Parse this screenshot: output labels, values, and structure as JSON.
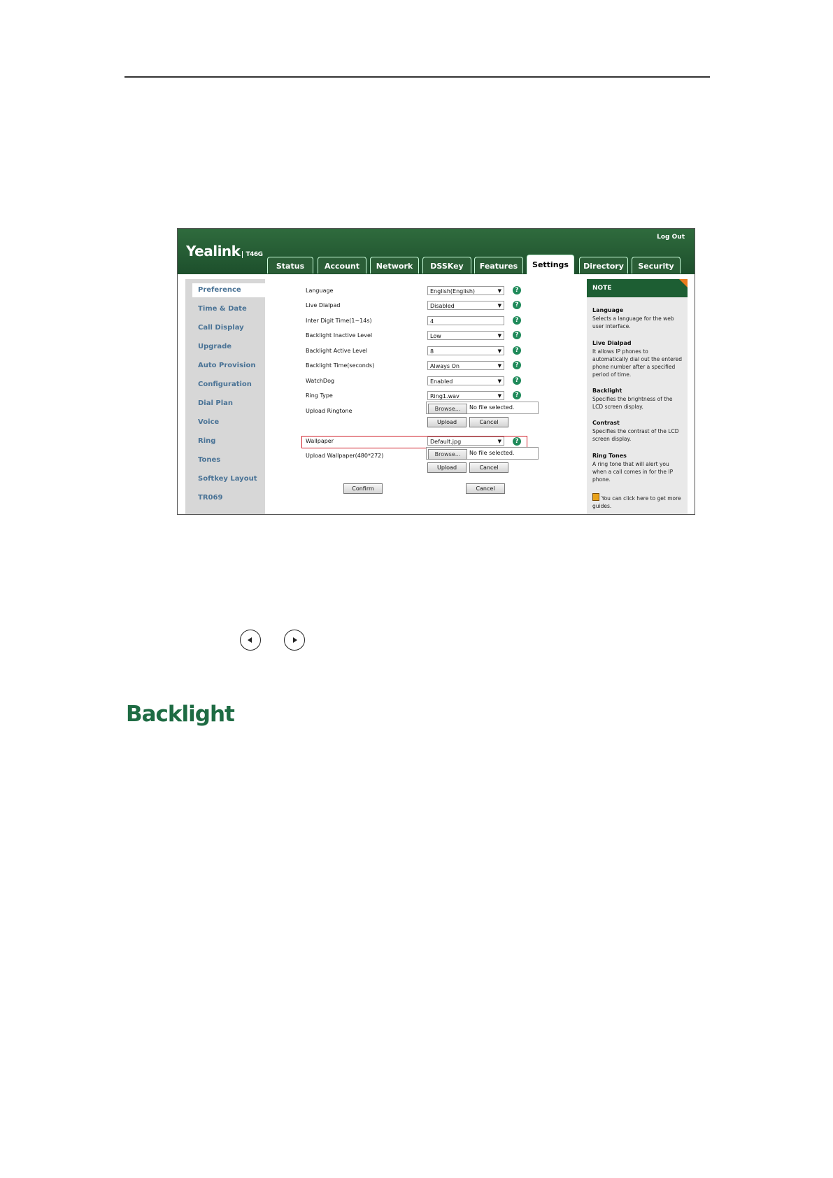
{
  "app": {
    "logo": "Yealink",
    "model": "T46G",
    "logout": "Log Out",
    "tabs": [
      "Status",
      "Account",
      "Network",
      "DSSKey",
      "Features",
      "Settings",
      "Directory",
      "Security"
    ],
    "active_tab": "Settings"
  },
  "sidebar": {
    "items": [
      "Preference",
      "Time & Date",
      "Call Display",
      "Upgrade",
      "Auto Provision",
      "Configuration",
      "Dial Plan",
      "Voice",
      "Ring",
      "Tones",
      "Softkey Layout",
      "TR069"
    ],
    "active": "Preference"
  },
  "form": {
    "language": {
      "label": "Language",
      "value": "English(English)"
    },
    "live_dialpad": {
      "label": "Live Dialpad",
      "value": "Disabled"
    },
    "inter_digit": {
      "label": "Inter Digit Time(1~14s)",
      "value": "4"
    },
    "backlight_inactive": {
      "label": "Backlight Inactive Level",
      "value": "Low"
    },
    "backlight_active": {
      "label": "Backlight Active Level",
      "value": "8"
    },
    "backlight_time": {
      "label": "Backlight Time(seconds)",
      "value": "Always On"
    },
    "watchdog": {
      "label": "WatchDog",
      "value": "Enabled"
    },
    "ring_type": {
      "label": "Ring Type",
      "value": "Ring1.wav"
    },
    "upload_ringtone": {
      "label": "Upload Ringtone"
    },
    "wallpaper": {
      "label": "Wallpaper",
      "value": "Default.jpg"
    },
    "upload_wallpaper": {
      "label": "Upload Wallpaper(480*272)"
    },
    "browse": "Browse...",
    "no_file": "No file selected.",
    "upload": "Upload",
    "cancel": "Cancel",
    "confirm": "Confirm"
  },
  "note": {
    "header": "NOTE",
    "language_title": "Language",
    "language_text": "Selects a language for the web user interface.",
    "live_dialpad_title": "Live Dialpad",
    "live_dialpad_text": "It allows IP phones to automatically dial out the entered phone number after a specified period of time.",
    "backlight_title": "Backlight",
    "backlight_text": "Specifies the brightness of the LCD screen display.",
    "contrast_title": "Contrast",
    "contrast_text": "Specifies the contrast of the LCD screen display.",
    "ring_tones_title": "Ring Tones",
    "ring_tones_text": "A ring tone that will alert you when a call comes in for the IP phone.",
    "guide_text": "You can click here to get more guides."
  },
  "page": {
    "heading": "Backlight"
  },
  "colors": {
    "brand_green": "#1d5e33",
    "heading_green": "#1e6b43",
    "highlight_red": "#d0202a",
    "sidebar_link": "#4a7396"
  }
}
